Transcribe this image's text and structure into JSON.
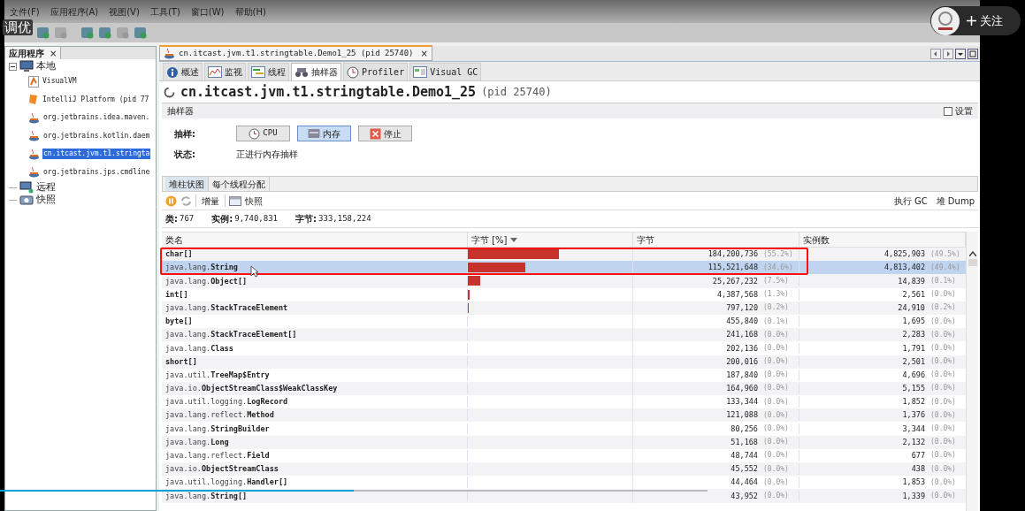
{
  "video_overlay": {
    "title": "调优",
    "follow_button": "关注",
    "progress": {
      "level": 0.5
    }
  },
  "menu": [
    "文件(F)",
    "应用程序(A)",
    "视图(V)",
    "工具(T)",
    "窗口(W)",
    "帮助(H)"
  ],
  "toolbar": [
    {
      "disabled": false
    },
    {
      "disabled": true
    },
    {
      "disabled": false
    },
    {
      "disabled": false
    },
    {
      "disabled": true
    },
    {
      "disabled": false
    }
  ],
  "sidebar": {
    "tab": "应用程序",
    "close": "×",
    "tree": [
      {
        "label": "本地",
        "expanded": true,
        "kind": "host",
        "children": [
          {
            "label": "VisualVM",
            "kind": "visualvm",
            "selected": false
          },
          {
            "label": "IntelliJ Platform (pid 77",
            "kind": "intellij",
            "selected": false
          },
          {
            "label": "org.jetbrains.idea.maven.",
            "kind": "java",
            "selected": false
          },
          {
            "label": "org.jetbrains.kotlin.daem",
            "kind": "java",
            "selected": false
          },
          {
            "label": "cn.itcast.jvm.t1.stringta",
            "kind": "java",
            "selected": true
          },
          {
            "label": "org.jetbrains.jps.cmdline",
            "kind": "java",
            "selected": false
          }
        ]
      },
      {
        "label": "远程",
        "kind": "remote"
      },
      {
        "label": "快照",
        "kind": "snapshot"
      }
    ]
  },
  "document_tab": {
    "label": "cn.itcast.jvm.t1.stringtable.Demo1_25 (pid 25740)",
    "close": "×"
  },
  "view_tabs": [
    {
      "label": "概述",
      "kind": "info",
      "selected": false
    },
    {
      "label": "监视",
      "kind": "monitor",
      "selected": false
    },
    {
      "label": "线程",
      "kind": "threads",
      "selected": false
    },
    {
      "label": "抽样器",
      "kind": "sampler",
      "selected": true
    },
    {
      "label": "Profiler",
      "kind": "profiler",
      "selected": false
    },
    {
      "label": "Visual GC",
      "kind": "gc",
      "selected": false
    }
  ],
  "heading": {
    "title": "cn.itcast.jvm.t1.stringtable.Demo1_25",
    "pid": "(pid 25740)"
  },
  "section": {
    "title": "抽样器",
    "settings": {
      "label": "设置",
      "checked": false
    }
  },
  "sampling": {
    "label": "抽样:",
    "buttons": [
      {
        "label": "CPU",
        "kind": "cpu",
        "selected": false
      },
      {
        "label": "内存",
        "kind": "memory",
        "selected": true
      },
      {
        "label": "停止",
        "kind": "stop",
        "selected": false
      }
    ],
    "status_label": "状态:",
    "status": "正进行内存抽样"
  },
  "result_tabs": [
    {
      "label": "堆柱状图",
      "selected": true
    },
    {
      "label": "每个线程分配",
      "selected": false
    }
  ],
  "result_toolbar": {
    "delta": "增量",
    "snapshot": "快照",
    "gc": "执行 GC",
    "dump": "堆 Dump"
  },
  "stats": [
    {
      "label": "类:",
      "value": "767"
    },
    {
      "label": "实例:",
      "value": "9,740,831"
    },
    {
      "label": "字节:",
      "value": "333,158,224"
    }
  ],
  "table": {
    "columns": [
      "类名",
      "字节 [%]",
      "字节",
      "实例数"
    ],
    "rows": [
      {
        "package": "",
        "class": "char[]",
        "level": 0.552,
        "bytes": "184,200,736",
        "bytes_pct": "(55.2%)",
        "instances": "4,825,903",
        "instances_pct": "(49.5%)",
        "selected": false
      },
      {
        "package": "java.lang.",
        "class": "String",
        "level": 0.346,
        "bytes": "115,521,648",
        "bytes_pct": "(34.6%)",
        "instances": "4,813,402",
        "instances_pct": "(49.4%)",
        "selected": true
      },
      {
        "package": "java.lang.",
        "class": "Object[]",
        "level": 0.075,
        "bytes": "25,267,232",
        "bytes_pct": "(7.5%)",
        "instances": "14,839",
        "instances_pct": "(0.1%)",
        "selected": false
      },
      {
        "package": "",
        "class": "int[]",
        "level": 0.013,
        "bytes": "4,387,568",
        "bytes_pct": "(1.3%)",
        "instances": "2,561",
        "instances_pct": "(0.0%)",
        "selected": false
      },
      {
        "package": "java.lang.",
        "class": "StackTraceElement",
        "level": 0.004,
        "bytes": "797,120",
        "bytes_pct": "(0.2%)",
        "instances": "24,910",
        "instances_pct": "(0.2%)",
        "selected": false
      },
      {
        "package": "",
        "class": "byte[]",
        "bytes": "455,840",
        "bytes_pct": "(0.1%)",
        "instances": "1,695",
        "instances_pct": "(0.0%)",
        "selected": false
      },
      {
        "package": "java.lang.",
        "class": "StackTraceElement[]",
        "bytes": "241,168",
        "bytes_pct": "(0.0%)",
        "instances": "2,283",
        "instances_pct": "(0.0%)",
        "selected": false
      },
      {
        "package": "java.lang.",
        "class": "Class",
        "bytes": "202,136",
        "bytes_pct": "(0.0%)",
        "instances": "1,791",
        "instances_pct": "(0.0%)",
        "selected": false
      },
      {
        "package": "",
        "class": "short[]",
        "bytes": "200,016",
        "bytes_pct": "(0.0%)",
        "instances": "2,501",
        "instances_pct": "(0.0%)",
        "selected": false
      },
      {
        "package": "java.util.",
        "class": "TreeMap$Entry",
        "bytes": "187,840",
        "bytes_pct": "(0.0%)",
        "instances": "4,696",
        "instances_pct": "(0.0%)",
        "selected": false
      },
      {
        "package": "java.io.",
        "class": "ObjectStreamClass$WeakClassKey",
        "bytes": "164,960",
        "bytes_pct": "(0.0%)",
        "instances": "5,155",
        "instances_pct": "(0.0%)",
        "selected": false
      },
      {
        "package": "java.util.logging.",
        "class": "LogRecord",
        "bytes": "133,344",
        "bytes_pct": "(0.0%)",
        "instances": "1,852",
        "instances_pct": "(0.0%)",
        "selected": false
      },
      {
        "package": "java.lang.reflect.",
        "class": "Method",
        "bytes": "121,088",
        "bytes_pct": "(0.0%)",
        "instances": "1,376",
        "instances_pct": "(0.0%)",
        "selected": false
      },
      {
        "package": "java.lang.",
        "class": "StringBuilder",
        "bytes": "80,256",
        "bytes_pct": "(0.0%)",
        "instances": "3,344",
        "instances_pct": "(0.0%)",
        "selected": false
      },
      {
        "package": "java.lang.",
        "class": "Long",
        "bytes": "51,168",
        "bytes_pct": "(0.0%)",
        "instances": "2,132",
        "instances_pct": "(0.0%)",
        "selected": false
      },
      {
        "package": "java.lang.reflect.",
        "class": "Field",
        "bytes": "48,744",
        "bytes_pct": "(0.0%)",
        "instances": "677",
        "instances_pct": "(0.0%)",
        "selected": false
      },
      {
        "package": "java.io.",
        "class": "ObjectStreamClass",
        "bytes": "45,552",
        "bytes_pct": "(0.0%)",
        "instances": "438",
        "instances_pct": "(0.0%)",
        "selected": false
      },
      {
        "package": "java.util.logging.",
        "class": "Handler[]",
        "bytes": "44,464",
        "bytes_pct": "(0.0%)",
        "instances": "1,853",
        "instances_pct": "(0.0%)",
        "selected": false
      },
      {
        "package": "java.lang.",
        "class": "String[]",
        "bytes": "43,952",
        "bytes_pct": "(0.0%)",
        "instances": "1,339",
        "instances_pct": "(0.0%)",
        "selected": false
      }
    ]
  }
}
